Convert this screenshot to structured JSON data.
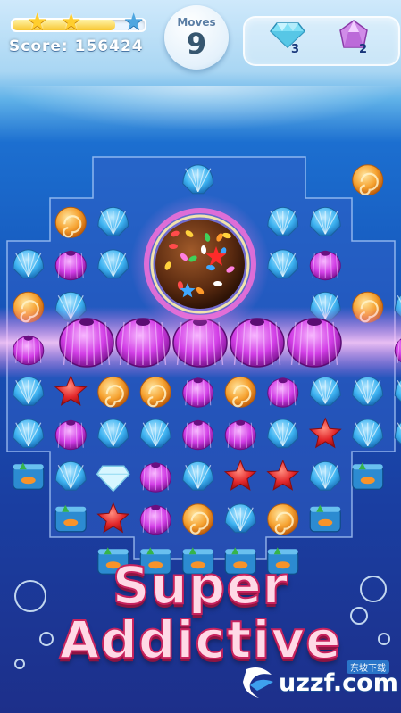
{
  "hud": {
    "stars_earned": 2,
    "stars_total": 3,
    "star_progress": 0.78,
    "score_label": "Score:",
    "score_value": "156424",
    "moves_label": "Moves",
    "moves_value": "9"
  },
  "goals": [
    {
      "icon": "diamond-icon",
      "count": "3",
      "color": "#6fd6f0"
    },
    {
      "icon": "gem-icon",
      "count": "2",
      "color": "#c67ce0"
    }
  ],
  "board": {
    "rows": [
      "  ..S.#.C. ",
      " CS.#.SS. ",
      "SUS.#.SU. ",
      "CS..B..SCS",
      "UUUUUUUUUU",
      "SFCCUCUSSS",
      "SUSSUUSFSS",
      "JSDUSFFSJ ",
      " JFUCSCJ  ",
      "  JJJJJ   "
    ],
    "legend": {
      "S": "shell",
      "C": "conch",
      "U": "urchin",
      "F": "starfish",
      "D": "diamond",
      "J": "jar",
      "B": "color-bomb"
    }
  },
  "colors": {
    "shell": "#3fb4f2",
    "conch": "#f6a230",
    "urchin": "#d23ee6",
    "starfish": "#e3272b",
    "bomb": "#5a2a10",
    "title_fill": "#ffd9e6",
    "title_stroke": "#c8235e"
  },
  "title": {
    "line1": "Super",
    "line2": "Addictive"
  },
  "watermark": {
    "top": "东坡下载",
    "main": "uzzf.com"
  }
}
